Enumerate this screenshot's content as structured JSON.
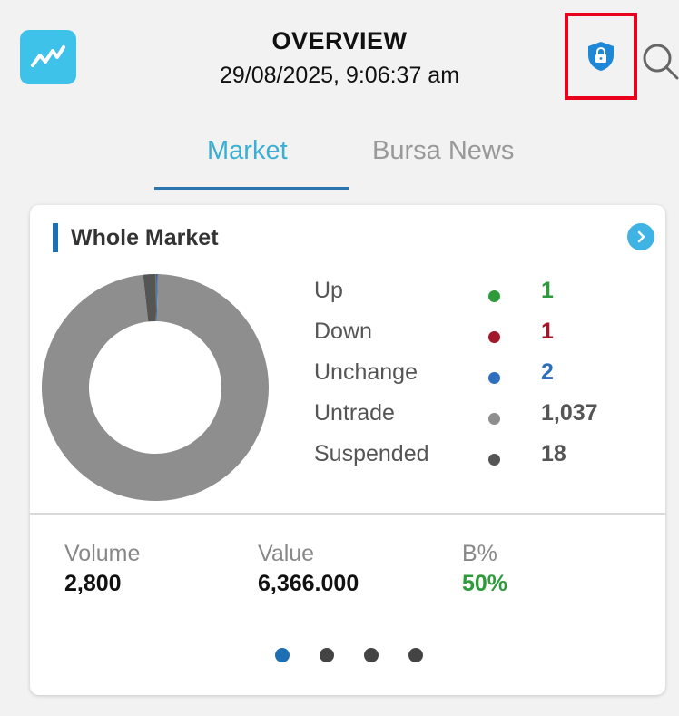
{
  "header": {
    "title": "OVERVIEW",
    "datetime": "29/08/2025, 9:06:37 am",
    "logo_icon": "trend-up-icon",
    "security_icon": "shield-lock-icon",
    "search_icon": "search-icon"
  },
  "tabs": [
    {
      "label": "Market",
      "active": true
    },
    {
      "label": "Bursa News",
      "active": false
    }
  ],
  "card": {
    "title": "Whole Market",
    "more_icon": "chevron-right-icon",
    "legend": [
      {
        "label": "Up",
        "value": "1",
        "color": "#2e9b3b"
      },
      {
        "label": "Down",
        "value": "1",
        "color": "#a3172b"
      },
      {
        "label": "Unchange",
        "value": "2",
        "color": "#2f6fc0"
      },
      {
        "label": "Untrade",
        "value": "1,037",
        "color": "#8e8e8e"
      },
      {
        "label": "Suspended",
        "value": "18",
        "color": "#555555"
      }
    ],
    "stats": {
      "volume_label": "Volume",
      "volume_value": "2,800",
      "value_label": "Value",
      "value_value": "6,366.000",
      "bpct_label": "B%",
      "bpct_value": "50%",
      "bpct_color": "#2e9b3b"
    },
    "pager": {
      "count": 4,
      "active_index": 0,
      "active_color": "#1d6fb3"
    }
  },
  "chart_data": {
    "type": "pie",
    "donut": true,
    "categories": [
      "Up",
      "Down",
      "Unchange",
      "Untrade",
      "Suspended"
    ],
    "values": [
      1,
      1,
      2,
      1037,
      18
    ],
    "colors": [
      "#2e9b3b",
      "#a3172b",
      "#2f6fc0",
      "#8e8e8e",
      "#555555"
    ]
  }
}
